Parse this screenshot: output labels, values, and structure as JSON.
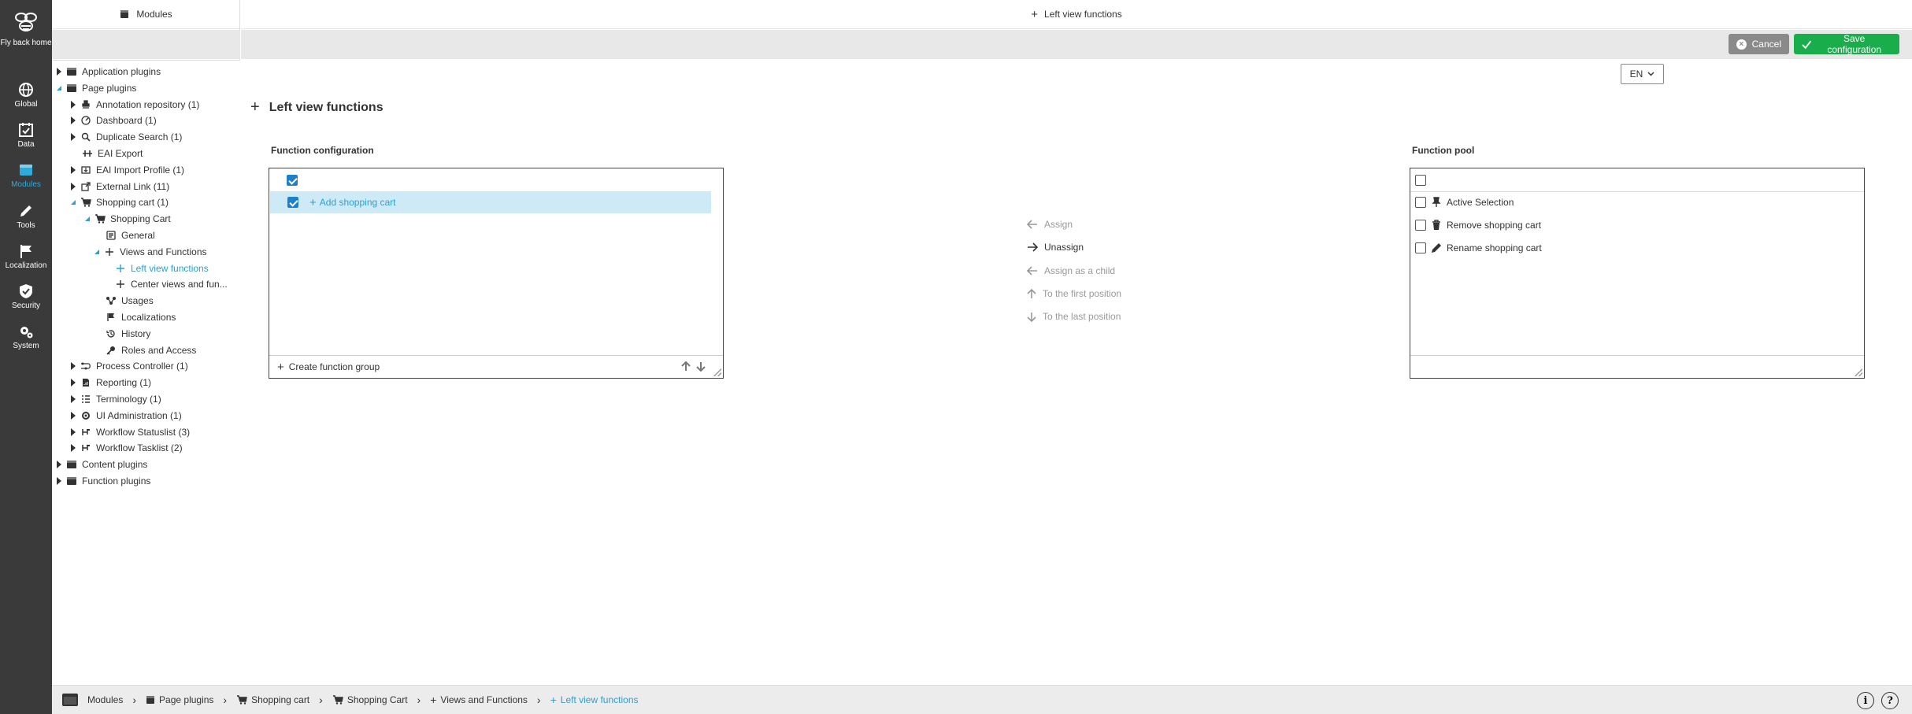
{
  "rail": {
    "items": [
      {
        "label": "Fly back home",
        "icon": "bee-icon"
      },
      {
        "label": "Global",
        "icon": "globe-icon"
      },
      {
        "label": "Data",
        "icon": "calendar-check-icon"
      },
      {
        "label": "Modules",
        "icon": "module-icon"
      },
      {
        "label": "Tools",
        "icon": "pencil-icon"
      },
      {
        "label": "Localization",
        "icon": "flag-icon"
      },
      {
        "label": "Security",
        "icon": "shield-icon"
      },
      {
        "label": "System",
        "icon": "gears-icon"
      }
    ],
    "active": "Modules",
    "active_color": "#2eaadc"
  },
  "tree_header": {
    "label": "Modules"
  },
  "tree": [
    {
      "label": "Application plugins",
      "icon": "plugin-icon",
      "arrow": "closed"
    },
    {
      "label": "Page plugins",
      "icon": "plugin-icon",
      "arrow": "open"
    },
    {
      "label": "Annotation repository (1)",
      "icon": "stamp-icon",
      "arrow": "closed"
    },
    {
      "label": "Dashboard (1)",
      "icon": "dashboard-icon",
      "arrow": "closed"
    },
    {
      "label": "Duplicate Search (1)",
      "icon": "search-icon",
      "arrow": "closed"
    },
    {
      "label": "EAI Export",
      "icon": "export-icon",
      "arrow": "none"
    },
    {
      "label": "EAI Import Profile (1)",
      "icon": "import-icon",
      "arrow": "closed"
    },
    {
      "label": "External Link (11)",
      "icon": "external-link-icon",
      "arrow": "closed"
    },
    {
      "label": "Shopping cart (1)",
      "icon": "cart-icon",
      "arrow": "open"
    },
    {
      "label": "Shopping Cart",
      "icon": "cart-icon",
      "arrow": "open"
    },
    {
      "label": "General",
      "icon": "general-icon",
      "arrow": "none"
    },
    {
      "label": "Views and Functions",
      "icon": "plus-icon",
      "arrow": "open"
    },
    {
      "label": "Left view functions",
      "icon": "plus-icon",
      "arrow": "none",
      "selected": true
    },
    {
      "label": "Center views and fun...",
      "icon": "plus-icon",
      "arrow": "none"
    },
    {
      "label": "Usages",
      "icon": "usages-icon",
      "arrow": "none"
    },
    {
      "label": "Localizations",
      "icon": "flag-icon",
      "arrow": "none"
    },
    {
      "label": "History",
      "icon": "history-icon",
      "arrow": "none"
    },
    {
      "label": "Roles and Access",
      "icon": "key-icon",
      "arrow": "none"
    },
    {
      "label": "Process Controller (1)",
      "icon": "process-icon",
      "arrow": "closed"
    },
    {
      "label": "Reporting (1)",
      "icon": "report-icon",
      "arrow": "closed"
    },
    {
      "label": "Terminology (1)",
      "icon": "list-icon",
      "arrow": "closed"
    },
    {
      "label": "UI Administration (1)",
      "icon": "ui-admin-icon",
      "arrow": "closed"
    },
    {
      "label": "Workflow Statuslist (3)",
      "icon": "workflow-icon",
      "arrow": "closed"
    },
    {
      "label": "Workflow Tasklist (2)",
      "icon": "workflow-icon",
      "arrow": "closed"
    },
    {
      "label": "Content plugins",
      "icon": "plugin-icon",
      "arrow": "closed"
    },
    {
      "label": "Function plugins",
      "icon": "plugin-icon",
      "arrow": "closed"
    }
  ],
  "main_header": {
    "label": "Left view functions"
  },
  "toolbar": {
    "cancel_label": "Cancel",
    "save_label": "Save configuration",
    "cancel_color": "#8a8a8a",
    "save_color": "#1aad4c"
  },
  "language": {
    "selected": "EN"
  },
  "page_title": "Left view functions",
  "function_configuration": {
    "title": "Function configuration",
    "items": [
      {
        "label": "Add shopping cart",
        "checked": true,
        "icon": "plus-icon"
      }
    ],
    "create_group_label": "Create function group"
  },
  "actions": [
    {
      "label": "Assign",
      "icon": "arrow-left-icon",
      "enabled": false
    },
    {
      "label": "Unassign",
      "icon": "arrow-right-icon",
      "enabled": true
    },
    {
      "label": "Assign as a child",
      "icon": "arrow-left-icon",
      "enabled": false
    },
    {
      "label": "To the first position",
      "icon": "arrow-up-icon",
      "enabled": false
    },
    {
      "label": "To the last position",
      "icon": "arrow-down-icon",
      "enabled": false
    }
  ],
  "function_pool": {
    "title": "Function pool",
    "items": [
      {
        "label": "Active Selection",
        "icon": "pin-icon",
        "checked": false
      },
      {
        "label": "Remove shopping cart",
        "icon": "trash-icon",
        "checked": false
      },
      {
        "label": "Rename shopping cart",
        "icon": "pencil-icon",
        "checked": false
      }
    ]
  },
  "breadcrumb": [
    {
      "label": "Modules",
      "icon": "module-icon"
    },
    {
      "label": "Page plugins",
      "icon": "plugin-icon"
    },
    {
      "label": "Shopping cart",
      "icon": "cart-icon"
    },
    {
      "label": "Shopping Cart",
      "icon": "cart-icon"
    },
    {
      "label": "Views and Functions",
      "icon": "plus-icon"
    },
    {
      "label": "Left view functions",
      "icon": "plus-icon"
    }
  ],
  "footer": {
    "info_label": "i",
    "help_label": "?"
  },
  "accent_color": "#2a9fd6"
}
